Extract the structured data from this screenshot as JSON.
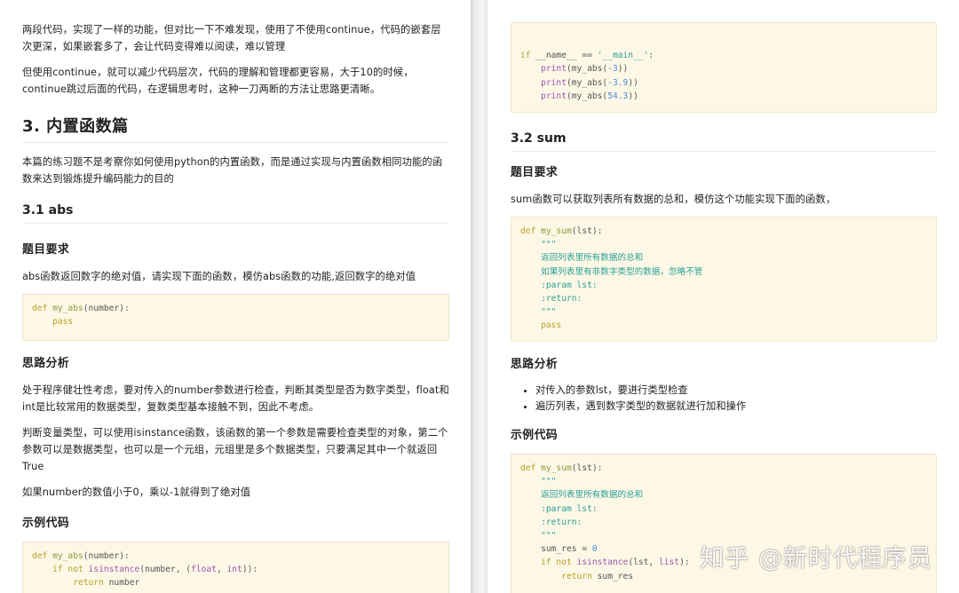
{
  "left": {
    "p1": "两段代码，实现了一样的功能，但对比一下不难发现，使用了不使用continue，代码的嵌套层次更深，如果嵌套多了，会让代码变得难以阅读，难以管理",
    "p2": "但使用continue，就可以减少代码层次，代码的理解和管理都更容易，大于10的时候，continue跳过后面的代码，在逻辑思考时，这种一刀两断的方法让思路更清晰。",
    "h2": "3. 内置函数篇",
    "p3": "本篇的练习题不是考察你如何使用python的内置函数，而是通过实现与内置函数相同功能的函数来达到锻炼提升编码能力的目的",
    "h3": "3.1 abs",
    "h4_req": "题目要求",
    "p4": "abs函数返回数字的绝对值，请实现下面的函数，模仿abs函数的功能,返回数字的绝对值",
    "code1": [
      [
        {
          "t": "def ",
          "c": "kw"
        },
        {
          "t": "my_abs",
          "c": "fn"
        },
        {
          "t": "(number):",
          "c": "op"
        }
      ],
      [
        {
          "t": "    pass",
          "c": "kw"
        }
      ]
    ],
    "h4_analysis": "思路分析",
    "p5": "处于程序健壮性考虑，要对传入的number参数进行检查，判断其类型是否为数字类型，float和int是比较常用的数据类型，复数类型基本接触不到，因此不考虑。",
    "p6": "判断变量类型，可以使用isinstance函数，该函数的第一个参数是需要检查类型的对象，第二个参数可以是数据类型，也可以是一个元组，元组里是多个数据类型，只要满足其中一个就返回True",
    "p7": "如果number的数值小于0，乘以-1就得到了绝对值",
    "h4_example": "示例代码",
    "code2": [
      [
        {
          "t": "def ",
          "c": "kw"
        },
        {
          "t": "my_abs",
          "c": "fn"
        },
        {
          "t": "(number):",
          "c": "op"
        }
      ],
      [
        {
          "t": "    if not ",
          "c": "kw"
        },
        {
          "t": "isinstance",
          "c": "bi"
        },
        {
          "t": "(number, (",
          "c": "op"
        },
        {
          "t": "float",
          "c": "bi"
        },
        {
          "t": ", ",
          "c": "op"
        },
        {
          "t": "int",
          "c": "bi"
        },
        {
          "t": ")):",
          "c": "op"
        }
      ],
      [
        {
          "t": "        return ",
          "c": "kw"
        },
        {
          "t": "number",
          "c": "op"
        }
      ]
    ]
  },
  "right": {
    "code0": [
      [
        {
          "t": "",
          "c": "op"
        }
      ],
      [
        {
          "t": "if ",
          "c": "kw"
        },
        {
          "t": "__name__ ",
          "c": "op"
        },
        {
          "t": "== ",
          "c": "op"
        },
        {
          "t": "'__main__'",
          "c": "str"
        },
        {
          "t": ":",
          "c": "op"
        }
      ],
      [
        {
          "t": "    print",
          "c": "bi"
        },
        {
          "t": "(my_abs(",
          "c": "op"
        },
        {
          "t": "-3",
          "c": "num"
        },
        {
          "t": "))",
          "c": "op"
        }
      ],
      [
        {
          "t": "    print",
          "c": "bi"
        },
        {
          "t": "(my_abs(",
          "c": "op"
        },
        {
          "t": "-3.9",
          "c": "num"
        },
        {
          "t": "))",
          "c": "op"
        }
      ],
      [
        {
          "t": "    print",
          "c": "bi"
        },
        {
          "t": "(my_abs(",
          "c": "op"
        },
        {
          "t": "54.3",
          "c": "num"
        },
        {
          "t": "))",
          "c": "op"
        }
      ]
    ],
    "h3": "3.2 sum",
    "h4_req": "题目要求",
    "p1": "sum函数可以获取列表所有数据的总和，模仿这个功能实现下面的函数，",
    "code1": [
      [
        {
          "t": "def ",
          "c": "kw"
        },
        {
          "t": "my_sum",
          "c": "fn"
        },
        {
          "t": "(lst):",
          "c": "op"
        }
      ],
      [
        {
          "t": "    \"\"\"",
          "c": "cm"
        }
      ],
      [
        {
          "t": "    返回列表里所有数据的总和",
          "c": "cm"
        }
      ],
      [
        {
          "t": "    如果列表里有非数字类型的数据，忽略不管",
          "c": "cm"
        }
      ],
      [
        {
          "t": "    :param lst:",
          "c": "cm"
        }
      ],
      [
        {
          "t": "    :return:",
          "c": "cm"
        }
      ],
      [
        {
          "t": "    \"\"\"",
          "c": "cm"
        }
      ],
      [
        {
          "t": "    pass",
          "c": "kw"
        }
      ]
    ],
    "h4_analysis": "思路分析",
    "bullets": [
      "对传入的参数lst，要进行类型检查",
      "遍历列表，遇到数字类型的数据就进行加和操作"
    ],
    "h4_example": "示例代码",
    "code2": [
      [
        {
          "t": "def ",
          "c": "kw"
        },
        {
          "t": "my_sum",
          "c": "fn"
        },
        {
          "t": "(lst):",
          "c": "op"
        }
      ],
      [
        {
          "t": "    \"\"\"",
          "c": "cm"
        }
      ],
      [
        {
          "t": "    返回列表里所有数据的总和",
          "c": "cm"
        }
      ],
      [
        {
          "t": "    :param lst:",
          "c": "cm"
        }
      ],
      [
        {
          "t": "    :return:",
          "c": "cm"
        }
      ],
      [
        {
          "t": "    \"\"\"",
          "c": "cm"
        }
      ],
      [
        {
          "t": "    sum_res ",
          "c": "op"
        },
        {
          "t": "= ",
          "c": "op"
        },
        {
          "t": "0",
          "c": "num"
        }
      ],
      [
        {
          "t": "    if not ",
          "c": "kw"
        },
        {
          "t": "isinstance",
          "c": "bi"
        },
        {
          "t": "(lst, ",
          "c": "op"
        },
        {
          "t": "list",
          "c": "bi"
        },
        {
          "t": "):",
          "c": "op"
        }
      ],
      [
        {
          "t": "        return ",
          "c": "kw"
        },
        {
          "t": "sum_res",
          "c": "op"
        }
      ]
    ]
  },
  "watermark": "知乎 @新时代程序员"
}
